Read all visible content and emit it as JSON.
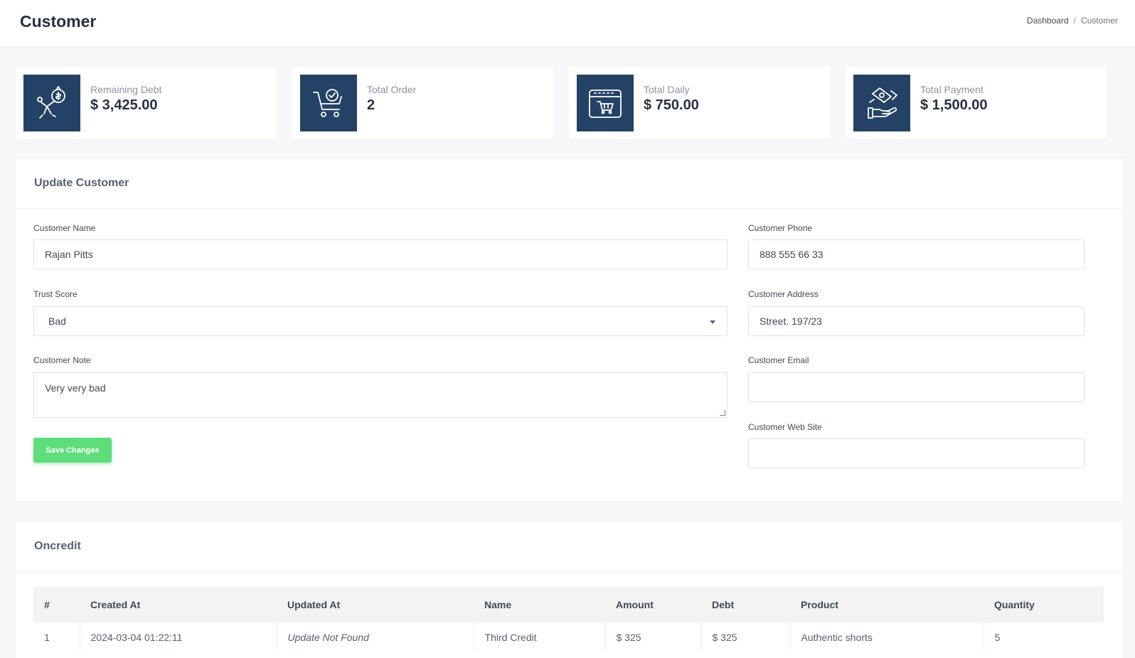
{
  "header": {
    "title": "Customer",
    "breadcrumb": {
      "home": "Dashboard",
      "separator": "/",
      "current": "Customer"
    }
  },
  "stats": [
    {
      "label": "Remaining Debt",
      "value": "$ 3,425.00",
      "icon": "debt-icon"
    },
    {
      "label": "Total Order",
      "value": "2",
      "icon": "cart-check-icon"
    },
    {
      "label": "Total Daily",
      "value": "$ 750.00",
      "icon": "calendar-cart-icon"
    },
    {
      "label": "Total Payment",
      "value": "$ 1,500.00",
      "icon": "handshake-payment-icon"
    }
  ],
  "update_form": {
    "title": "Update Customer",
    "fields": {
      "name": {
        "label": "Customer Name",
        "value": "Rajan Pitts"
      },
      "trust": {
        "label": "Trust Score",
        "value": "Bad"
      },
      "note": {
        "label": "Customer Note",
        "value": "Very very bad"
      },
      "phone": {
        "label": "Customer Phone",
        "value": "888 555 66 33"
      },
      "address": {
        "label": "Customer Address",
        "value": "Street. 197/23"
      },
      "email": {
        "label": "Customer Email",
        "value": ""
      },
      "website": {
        "label": "Customer Web Site",
        "value": ""
      }
    },
    "save_label": "Save Changes"
  },
  "oncredit": {
    "title": "Oncredit",
    "columns": [
      "#",
      "Created At",
      "Updated At",
      "Name",
      "Amount",
      "Debt",
      "Product",
      "Quantity"
    ],
    "rows": [
      [
        "1",
        "2024-03-04 01:22:11",
        "Update Not Found",
        "Third Credit",
        "$ 325",
        "$ 325",
        "Authentic shorts",
        "5"
      ]
    ]
  },
  "colors": {
    "icon_bg": "#234266",
    "save_button": "#5dde7a"
  }
}
